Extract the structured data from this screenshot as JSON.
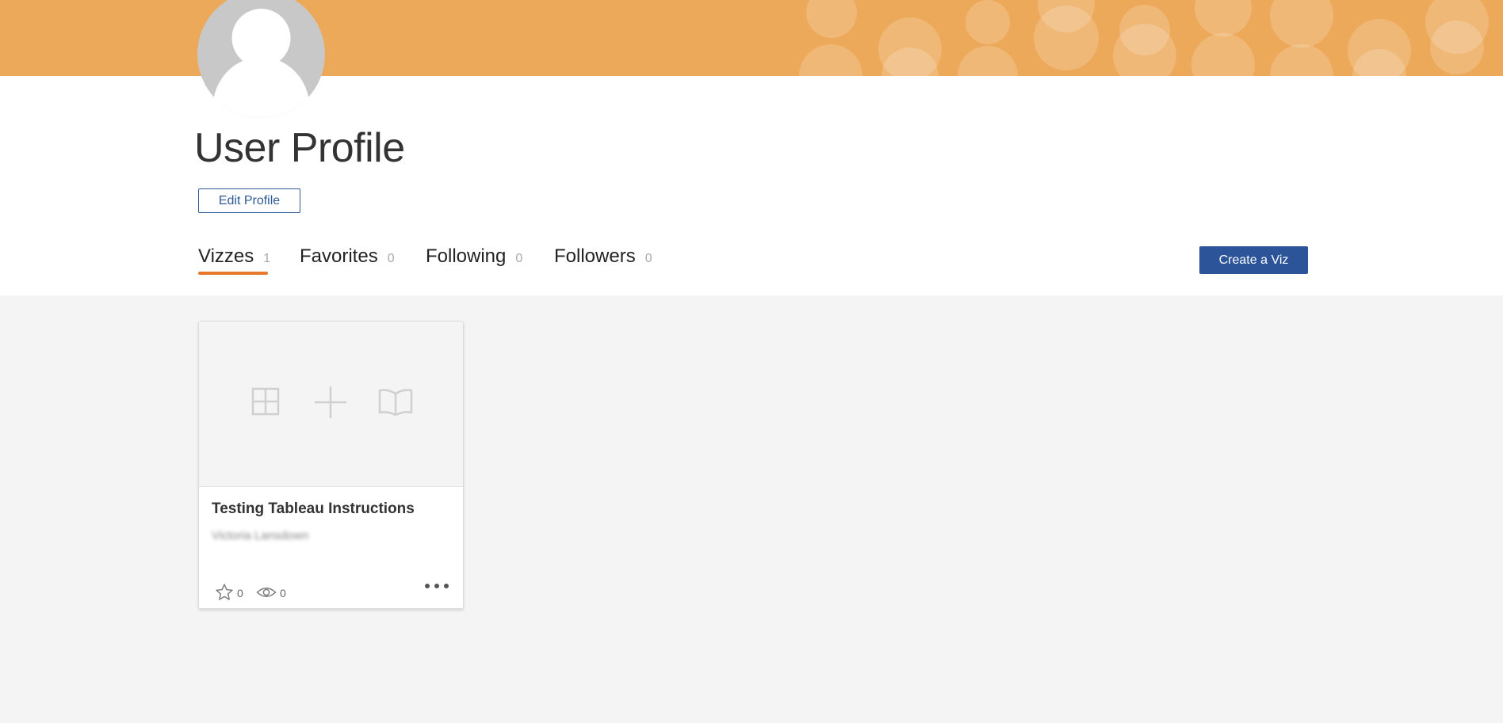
{
  "profile": {
    "title": "User Profile",
    "edit_label": "Edit Profile"
  },
  "tabs": [
    {
      "label": "Vizzes",
      "count": "1",
      "active": true
    },
    {
      "label": "Favorites",
      "count": "0",
      "active": false
    },
    {
      "label": "Following",
      "count": "0",
      "active": false
    },
    {
      "label": "Followers",
      "count": "0",
      "active": false
    }
  ],
  "create_viz_label": "Create a Viz",
  "cards": [
    {
      "title": "Testing Tableau Instructions",
      "author": "Victoria Lansdown",
      "favorites": "0",
      "views": "0",
      "thumbnail_icons": [
        "grid-icon",
        "plus-icon",
        "book-icon"
      ]
    }
  ],
  "icons": {
    "favorite": "star-icon",
    "views": "eye-icon",
    "more": "more-options-icon"
  },
  "colors": {
    "banner": "#eda95a",
    "accent_underline": "#e8762d",
    "primary_button": "#2c5599",
    "outline_button": "#2c5a96",
    "page_background": "#f4f4f4"
  }
}
